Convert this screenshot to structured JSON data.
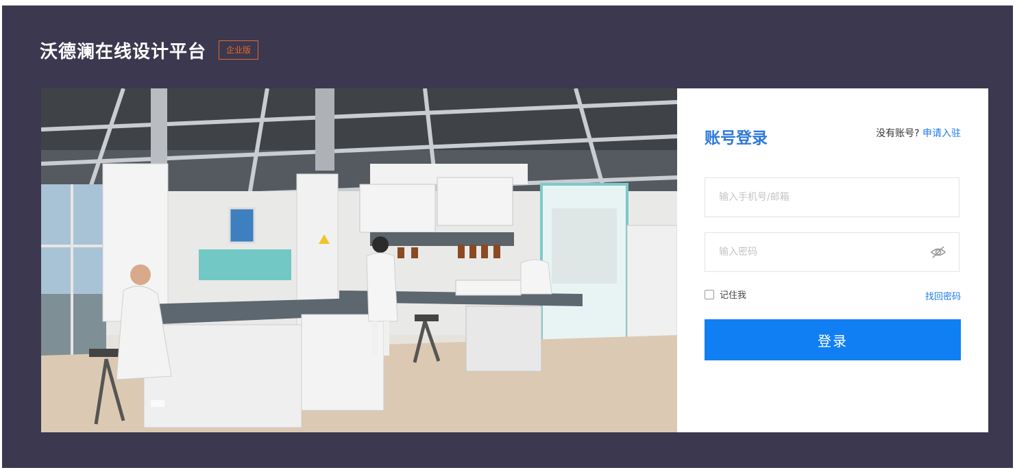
{
  "brand": {
    "title": "沃德澜在线设计平台",
    "badge": "企业版"
  },
  "hero": {
    "image": "laboratory-photo"
  },
  "login": {
    "title": "账号登录",
    "signup_prompt": "没有账号?",
    "signup_link": "申请入驻",
    "account_placeholder": "输入手机号/邮箱",
    "password_placeholder": "输入密码",
    "password_toggle_icon": "eye-off-icon",
    "remember_label": "记住我",
    "forgot_link": "找回密码",
    "submit_label": "登录"
  },
  "colors": {
    "background": "#3b384f",
    "accent": "#0f7ff3",
    "badge": "#e8692a",
    "title": "#2e78d8"
  }
}
